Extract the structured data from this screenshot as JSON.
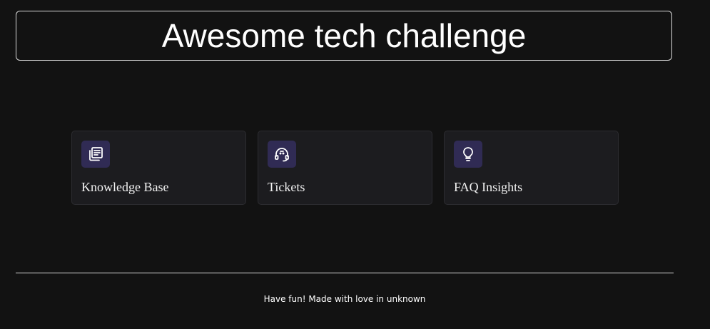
{
  "header": {
    "title": "Awesome tech challenge"
  },
  "cards": [
    {
      "label": "Knowledge Base",
      "icon": "news-icon"
    },
    {
      "label": "Tickets",
      "icon": "headset-icon"
    },
    {
      "label": "FAQ Insights",
      "icon": "lightbulb-icon"
    }
  ],
  "footer": {
    "text": "Have fun! Made with love in unknown"
  },
  "colors": {
    "background": "#121212",
    "card_background": "#1c1c1f",
    "icon_background": "#302b54",
    "text": "#ffffff"
  }
}
